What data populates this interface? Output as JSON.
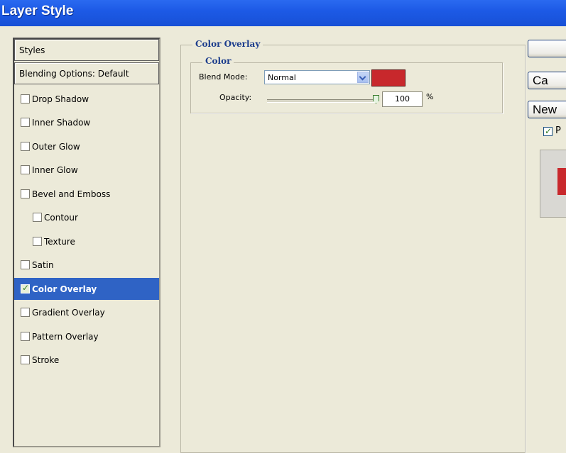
{
  "window": {
    "title": "Layer Style"
  },
  "styles_list": {
    "header": "Styles",
    "blending": "Blending Options: Default",
    "items": [
      {
        "label": "Drop Shadow",
        "checked": false,
        "selected": false
      },
      {
        "label": "Inner Shadow",
        "checked": false,
        "selected": false
      },
      {
        "label": "Outer Glow",
        "checked": false,
        "selected": false
      },
      {
        "label": "Inner Glow",
        "checked": false,
        "selected": false
      },
      {
        "label": "Bevel and Emboss",
        "checked": false,
        "selected": false
      },
      {
        "label": "Contour",
        "checked": false,
        "selected": false
      },
      {
        "label": "Texture",
        "checked": false,
        "selected": false
      },
      {
        "label": "Satin",
        "checked": false,
        "selected": false
      },
      {
        "label": "Color Overlay",
        "checked": true,
        "selected": true
      },
      {
        "label": "Gradient Overlay",
        "checked": false,
        "selected": false
      },
      {
        "label": "Pattern Overlay",
        "checked": false,
        "selected": false
      },
      {
        "label": "Stroke",
        "checked": false,
        "selected": false
      }
    ]
  },
  "color_overlay": {
    "group_title": "Color Overlay",
    "subgroup_title": "Color",
    "blend_mode_label": "Blend Mode:",
    "blend_mode_value": "Normal",
    "opacity_label": "Opacity:",
    "opacity_value": "100",
    "opacity_unit": "%",
    "color": "#c8282c"
  },
  "buttons": {
    "ok": "",
    "cancel": "Ca",
    "new_style": "New"
  },
  "preview_label": "P",
  "colors": {
    "titlebar": "#1d5ae6",
    "selection": "#2f63c5",
    "overlay_color": "#c8282c"
  }
}
